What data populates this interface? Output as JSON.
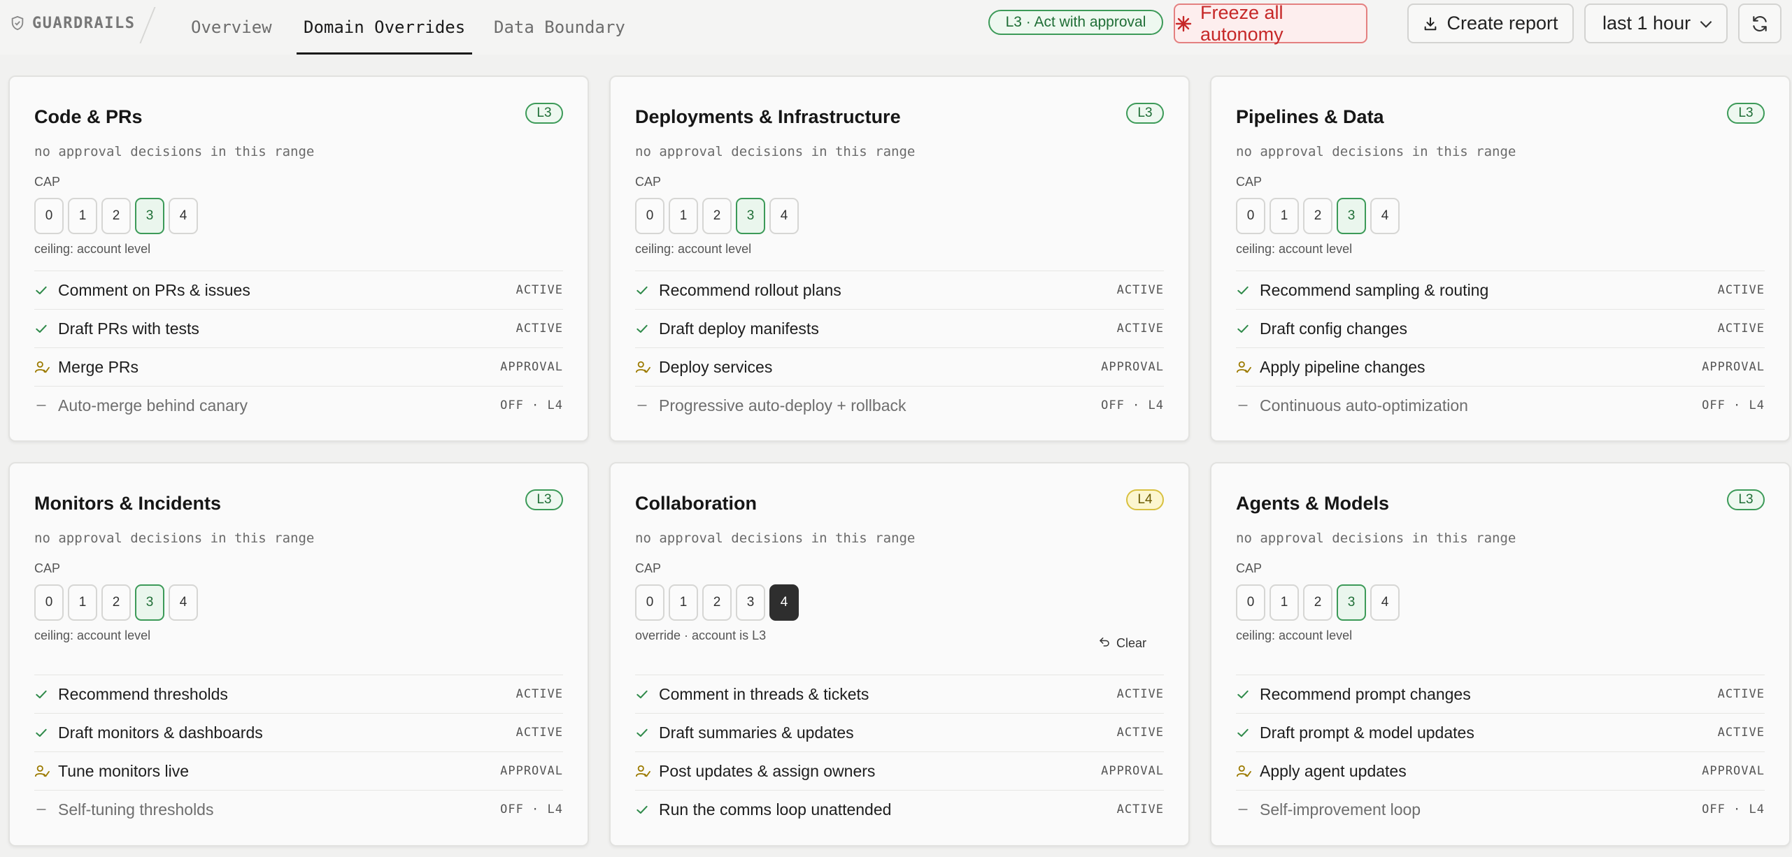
{
  "app": {
    "brand": "GUARDRAILS"
  },
  "tabs": [
    {
      "label": "Overview",
      "active": false
    },
    {
      "label": "Domain Overrides",
      "active": true
    },
    {
      "label": "Data Boundary",
      "active": false
    }
  ],
  "toolbar": {
    "level_pill": "L3 · Act with approval",
    "freeze_label": "Freeze all autonomy",
    "report_label": "Create report",
    "range_label": "last 1 hour"
  },
  "colors": {
    "accent_green": "#3c9a58",
    "danger_red": "#c62828",
    "warn_yellow": "#d8c040"
  },
  "cap_levels": [
    "0",
    "1",
    "2",
    "3",
    "4"
  ],
  "cap_label": "CAP",
  "cards": [
    {
      "title": "Code & PRs",
      "level": "L3",
      "subtitle": "no approval decisions in this range",
      "cap_selected": 3,
      "ceiling": "ceiling: account level",
      "rules": [
        {
          "label": "Comment on PRs & issues",
          "status": "ACTIVE",
          "icon": "check-icon"
        },
        {
          "label": "Draft PRs with tests",
          "status": "ACTIVE",
          "icon": "check-icon"
        },
        {
          "label": "Merge PRs",
          "status": "APPROVAL",
          "icon": "approval-icon"
        },
        {
          "label": "Auto-merge behind canary",
          "status": "OFF · L4",
          "icon": "dash-icon"
        }
      ]
    },
    {
      "title": "Deployments & Infrastructure",
      "level": "L3",
      "subtitle": "no approval decisions in this range",
      "cap_selected": 3,
      "ceiling": "ceiling: account level",
      "rules": [
        {
          "label": "Recommend rollout plans",
          "status": "ACTIVE",
          "icon": "check-icon"
        },
        {
          "label": "Draft deploy manifests",
          "status": "ACTIVE",
          "icon": "check-icon"
        },
        {
          "label": "Deploy services",
          "status": "APPROVAL",
          "icon": "approval-icon"
        },
        {
          "label": "Progressive auto-deploy + rollback",
          "status": "OFF · L4",
          "icon": "dash-icon"
        }
      ]
    },
    {
      "title": "Pipelines & Data",
      "level": "L3",
      "subtitle": "no approval decisions in this range",
      "cap_selected": 3,
      "ceiling": "ceiling: account level",
      "rules": [
        {
          "label": "Recommend sampling & routing",
          "status": "ACTIVE",
          "icon": "check-icon"
        },
        {
          "label": "Draft config changes",
          "status": "ACTIVE",
          "icon": "check-icon"
        },
        {
          "label": "Apply pipeline changes",
          "status": "APPROVAL",
          "icon": "approval-icon"
        },
        {
          "label": "Continuous auto-optimization",
          "status": "OFF · L4",
          "icon": "dash-icon"
        }
      ]
    },
    {
      "title": "Monitors & Incidents",
      "level": "L3",
      "subtitle": "no approval decisions in this range",
      "cap_selected": 3,
      "ceiling": "ceiling: account level",
      "rules": [
        {
          "label": "Recommend thresholds",
          "status": "ACTIVE",
          "icon": "check-icon"
        },
        {
          "label": "Draft monitors & dashboards",
          "status": "ACTIVE",
          "icon": "check-icon"
        },
        {
          "label": "Tune monitors live",
          "status": "APPROVAL",
          "icon": "approval-icon"
        },
        {
          "label": "Self-tuning thresholds",
          "status": "OFF · L4",
          "icon": "dash-icon"
        }
      ]
    },
    {
      "title": "Collaboration",
      "level": "L4",
      "level_style": "warn",
      "subtitle": "no approval decisions in this range",
      "cap_selected": 4,
      "cap_override": true,
      "ceiling": "override · account is L3",
      "clear_label": "Clear",
      "rules": [
        {
          "label": "Comment in threads & tickets",
          "status": "ACTIVE",
          "icon": "check-icon"
        },
        {
          "label": "Draft summaries & updates",
          "status": "ACTIVE",
          "icon": "check-icon"
        },
        {
          "label": "Post updates & assign owners",
          "status": "APPROVAL",
          "icon": "approval-icon"
        },
        {
          "label": "Run the comms loop unattended",
          "status": "ACTIVE",
          "icon": "check-icon"
        }
      ]
    },
    {
      "title": "Agents & Models",
      "level": "L3",
      "subtitle": "no approval decisions in this range",
      "cap_selected": 3,
      "ceiling": "ceiling: account level",
      "rules": [
        {
          "label": "Recommend prompt changes",
          "status": "ACTIVE",
          "icon": "check-icon"
        },
        {
          "label": "Draft prompt & model updates",
          "status": "ACTIVE",
          "icon": "check-icon"
        },
        {
          "label": "Apply agent updates",
          "status": "APPROVAL",
          "icon": "approval-icon"
        },
        {
          "label": "Self-improvement loop",
          "status": "OFF · L4",
          "icon": "dash-icon"
        }
      ]
    }
  ]
}
